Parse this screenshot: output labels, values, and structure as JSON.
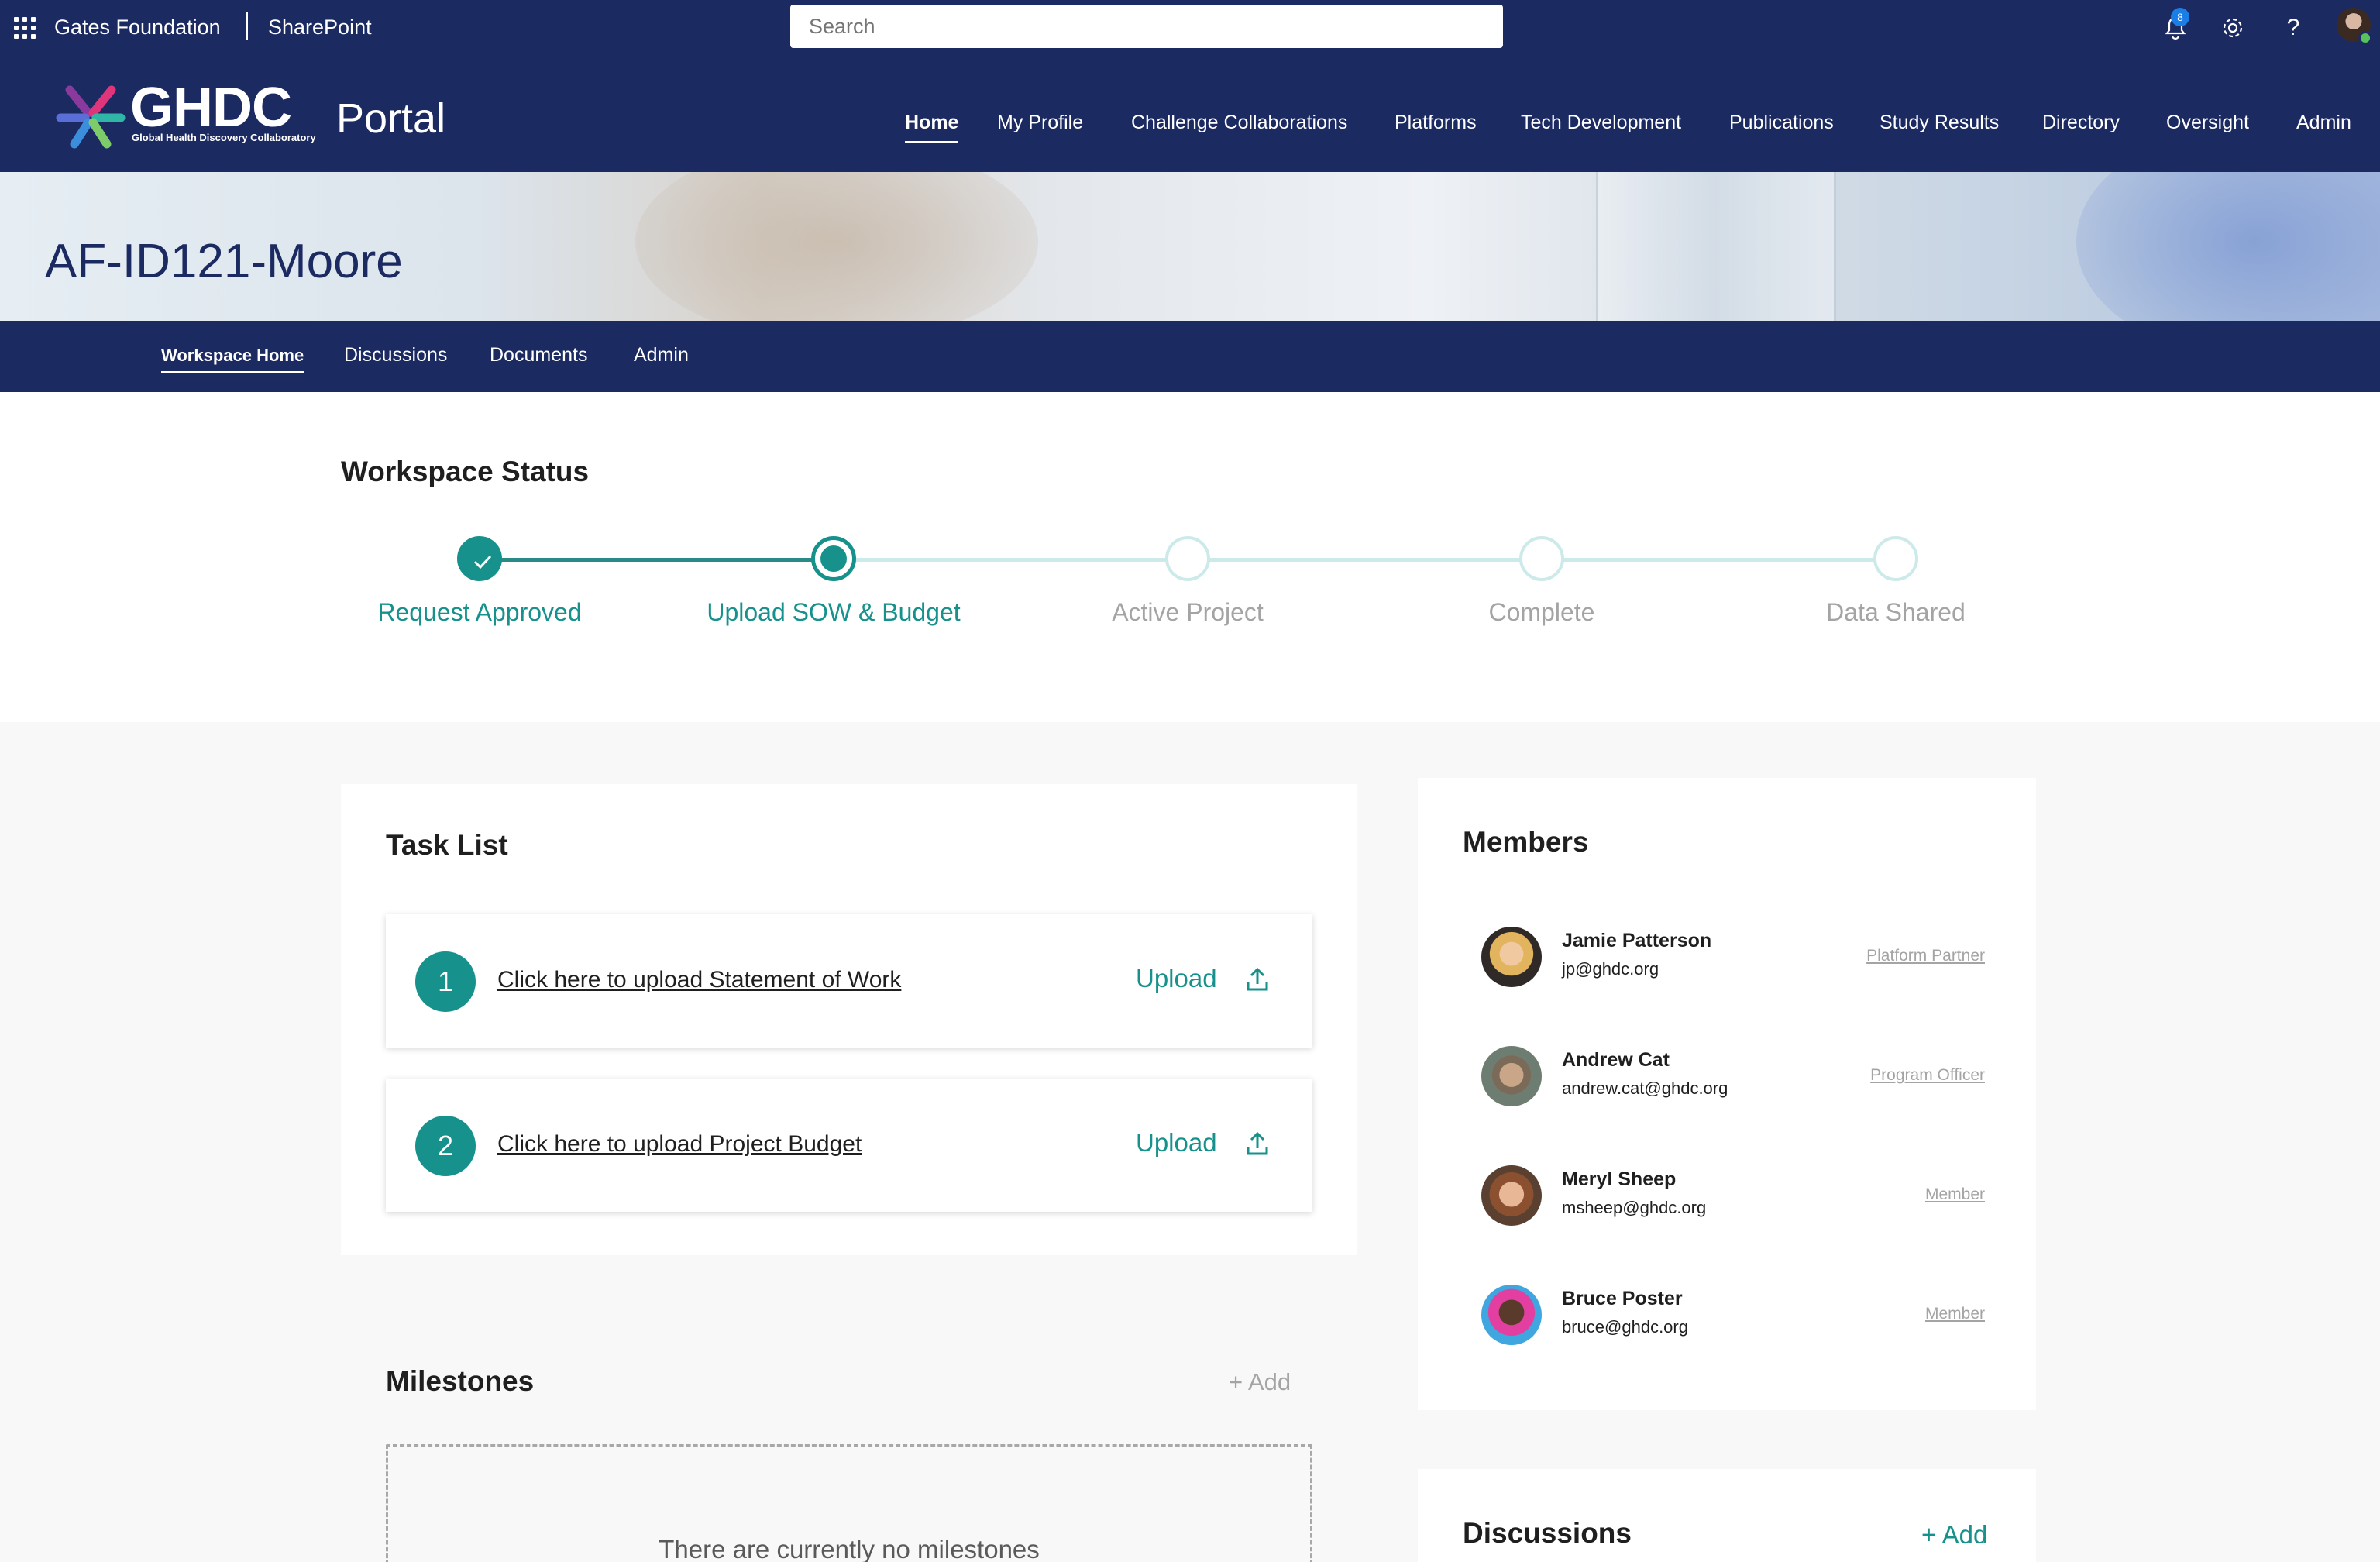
{
  "suitebar": {
    "org": "Gates Foundation",
    "app": "SharePoint",
    "search_placeholder": "Search",
    "notification_count": "8",
    "help_glyph": "?"
  },
  "site": {
    "logo_title": "GHDC",
    "logo_subtitle": "Global Health Discovery Collaboratory",
    "portal": "Portal",
    "nav": [
      {
        "label": "Home",
        "active": true
      },
      {
        "label": "My Profile"
      },
      {
        "label": "Challenge Collaborations"
      },
      {
        "label": "Platforms"
      },
      {
        "label": "Tech Development"
      },
      {
        "label": "Publications"
      },
      {
        "label": "Study Results"
      },
      {
        "label": "Directory"
      },
      {
        "label": "Oversight"
      },
      {
        "label": "Admin"
      }
    ]
  },
  "hero": {
    "title": "AF-ID121-Moore"
  },
  "workspace_nav": [
    {
      "label": "Workspace Home",
      "active": true
    },
    {
      "label": "Discussions"
    },
    {
      "label": "Documents"
    },
    {
      "label": "Admin"
    }
  ],
  "status": {
    "title": "Workspace Status",
    "steps": [
      {
        "label": "Request Approved",
        "state": "done"
      },
      {
        "label": "Upload SOW & Budget",
        "state": "current"
      },
      {
        "label": "Active Project",
        "state": "todo"
      },
      {
        "label": "Complete",
        "state": "todo"
      },
      {
        "label": "Data Shared",
        "state": "todo"
      }
    ]
  },
  "tasks": {
    "title": "Task List",
    "items": [
      {
        "number": "1",
        "link": "Click here to upload Statement of Work",
        "action": "Upload"
      },
      {
        "number": "2",
        "link": "Click here to upload Project Budget",
        "action": "Upload"
      }
    ]
  },
  "milestones": {
    "title": "Milestones",
    "add_label": "+ Add",
    "empty_text": "There are currently no milestones"
  },
  "members": {
    "title": "Members",
    "items": [
      {
        "name": "Jamie Patterson",
        "email": "jp@ghdc.org",
        "role": "Platform Partner"
      },
      {
        "name": "Andrew Cat",
        "email": "andrew.cat@ghdc.org",
        "role": "Program Officer"
      },
      {
        "name": "Meryl Sheep",
        "email": "msheep@ghdc.org",
        "role": "Member"
      },
      {
        "name": "Bruce Poster",
        "email": "bruce@ghdc.org",
        "role": "Member"
      }
    ]
  },
  "discussions": {
    "title": "Discussions",
    "add_label": "+ Add"
  },
  "colors": {
    "navy": "#1c2a62",
    "teal": "#16918c",
    "teal_light": "#cdeaea",
    "muted": "#a4a4a4"
  },
  "icons": {
    "waffle": "waffle-icon",
    "bell": "bell-icon",
    "gear": "gear-icon",
    "help": "help-icon",
    "upload": "upload-icon",
    "check": "check-icon"
  }
}
